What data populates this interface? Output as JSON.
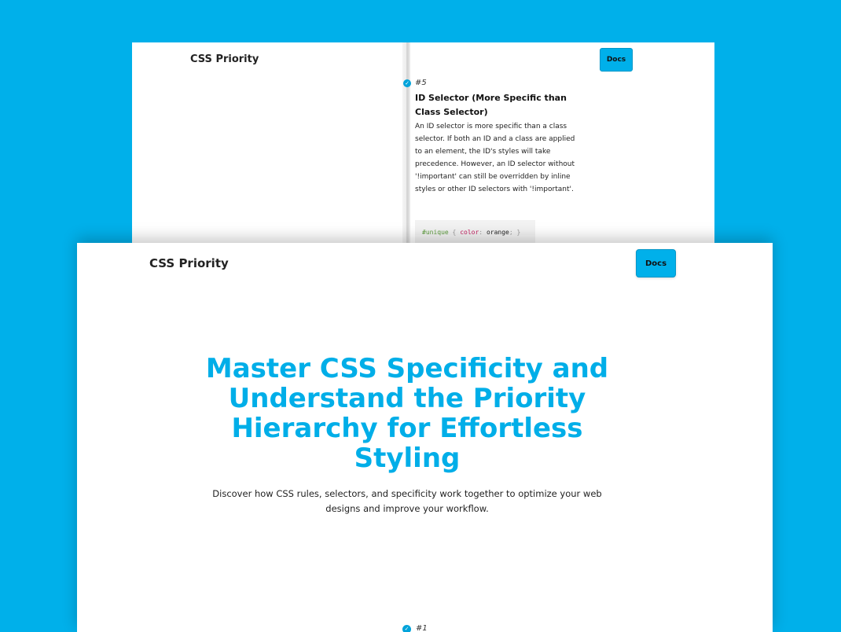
{
  "back_window": {
    "brand": "CSS Priority",
    "docs_label": "Docs",
    "card": {
      "step": "#5",
      "title": "ID Selector (More Specific than Class Selector)",
      "description": "An ID selector is more specific than a class selector. If both an ID and a class are applied to an element, the ID's styles will take precedence. However, an ID selector without '!important' can still be overridden by inline styles or other ID selectors with '!important'.",
      "code": {
        "selector": "#unique",
        "open": "{",
        "property": "color",
        "colon": ":",
        "value": "orange",
        "semicolon": ";",
        "close": "}"
      }
    }
  },
  "front_window": {
    "brand": "CSS Priority",
    "docs_label": "Docs",
    "hero_title": "Master CSS Specificity and Understand the Priority Hierarchy for Effortless Styling",
    "hero_subtitle": "Discover how CSS rules, selectors, and specificity work together to optimize your web designs and improve your workflow.",
    "first_step": "#1"
  },
  "icons": {
    "check": "check-circle-icon"
  },
  "colors": {
    "accent": "#00b0ea",
    "background": "#00b0ea",
    "title": "#00aee8"
  }
}
